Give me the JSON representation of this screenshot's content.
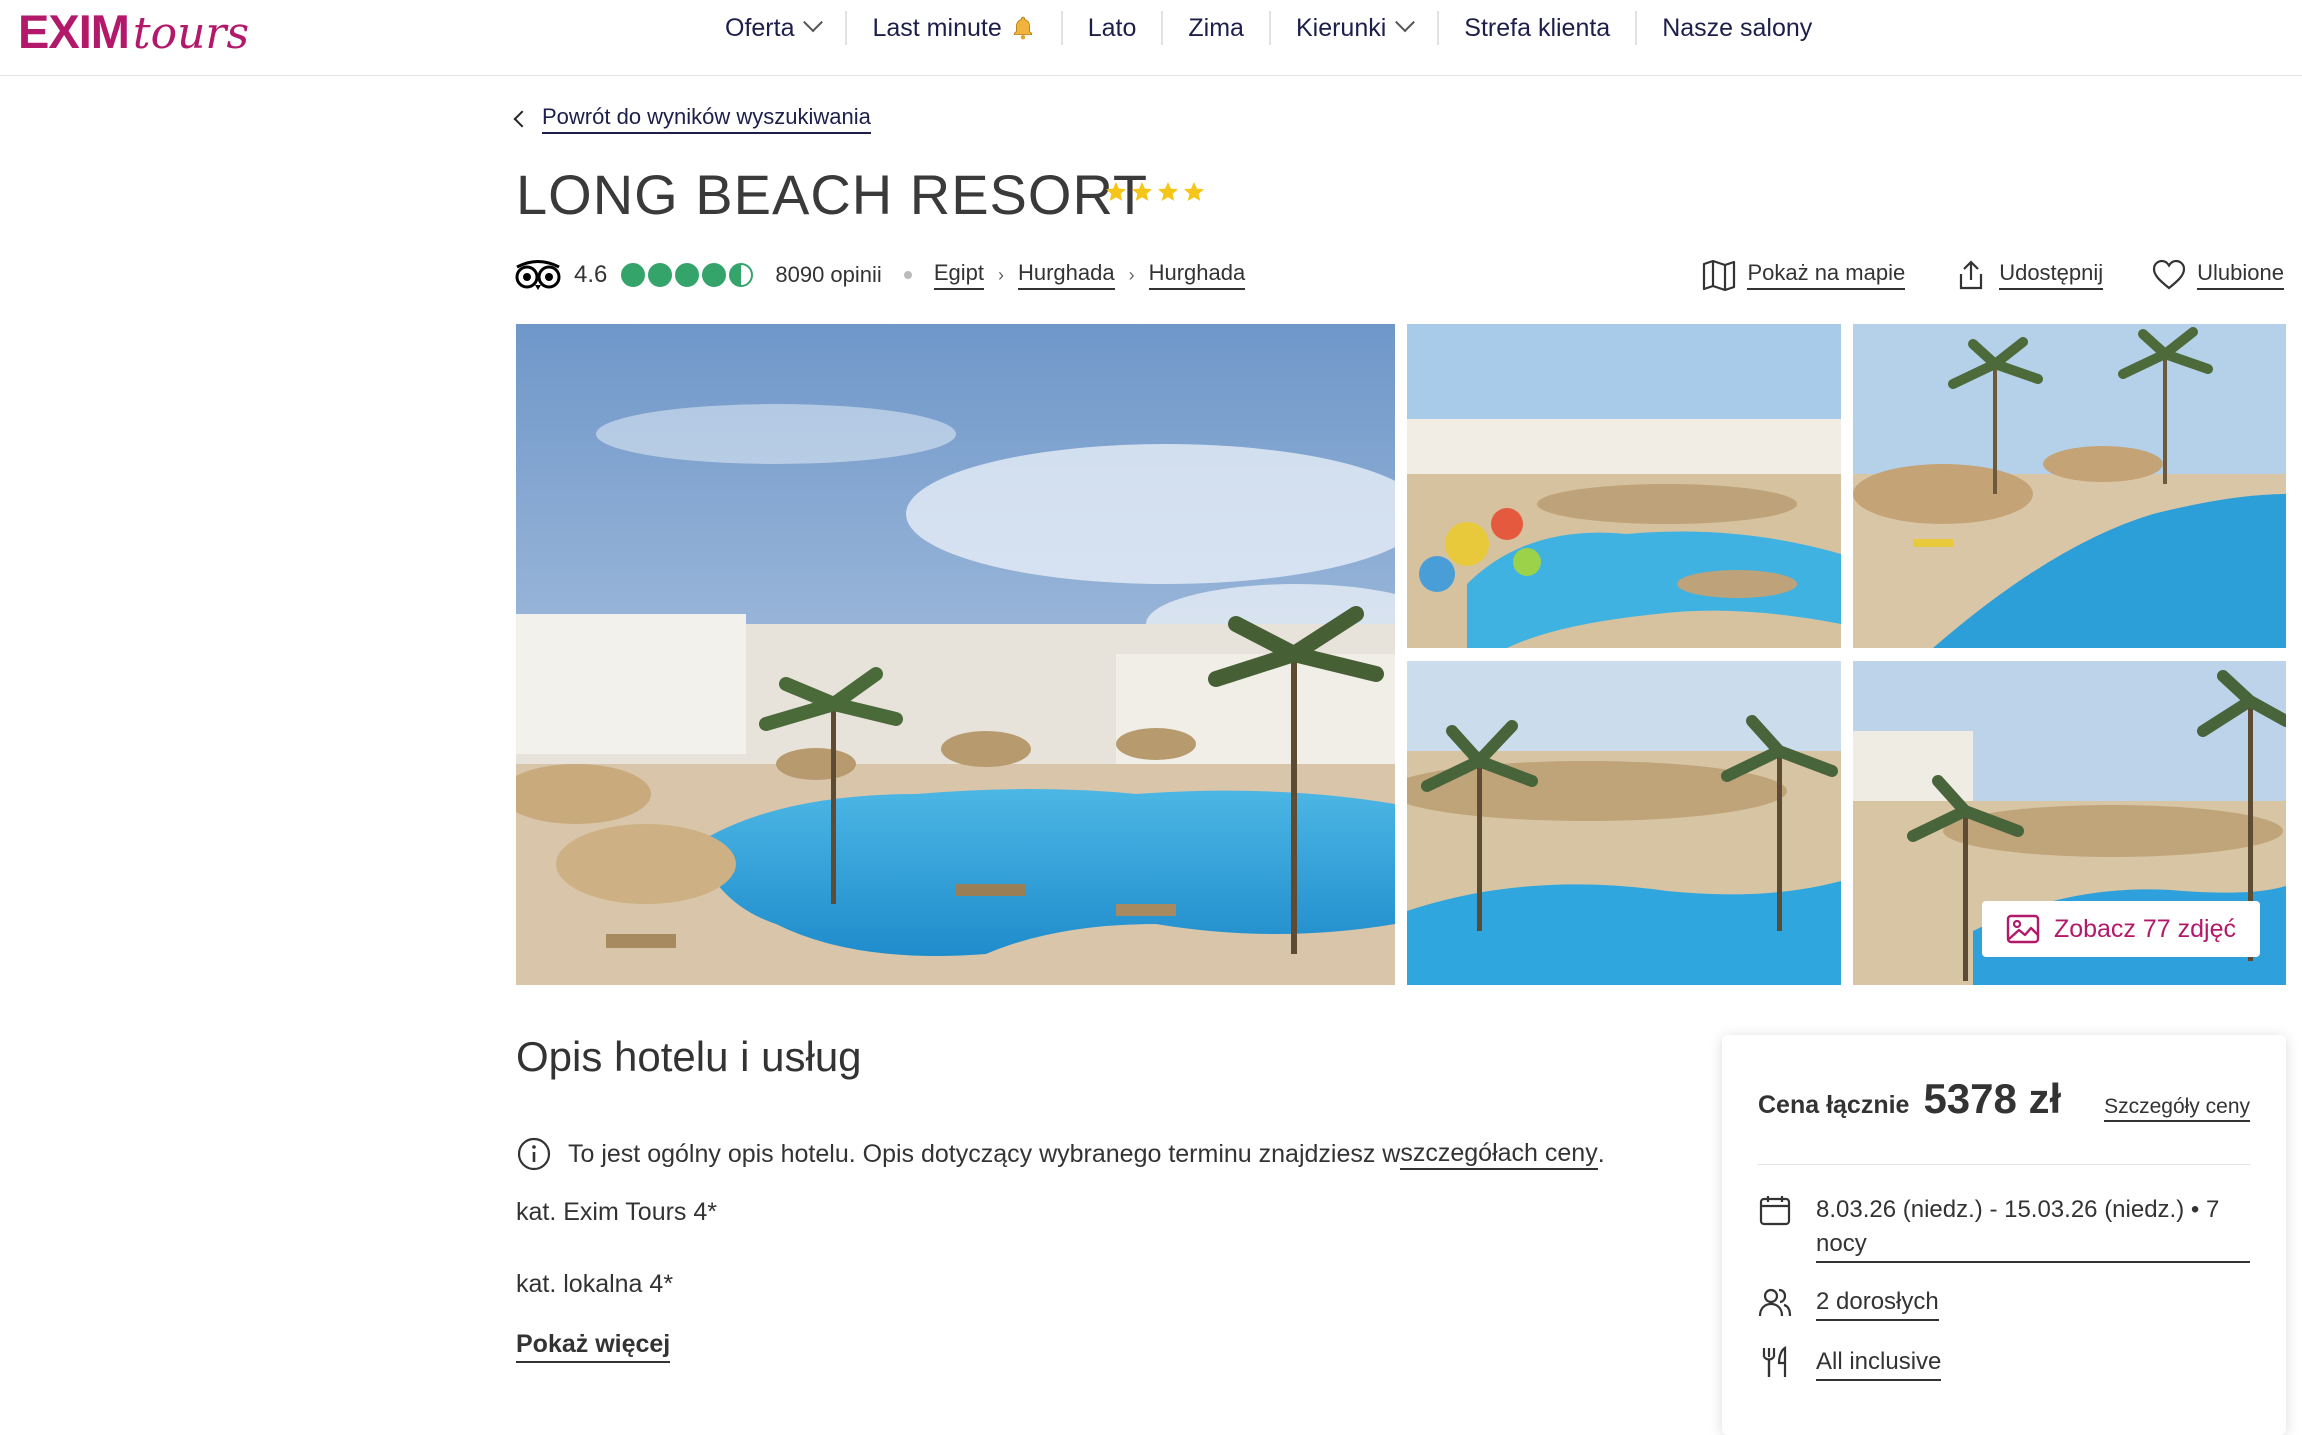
{
  "header": {
    "logo_main": "EXIM",
    "logo_script": "tours",
    "nav": [
      {
        "label": "Oferta",
        "dropdown": true
      },
      {
        "label": "Last minute",
        "icon": "bell-icon"
      },
      {
        "label": "Lato"
      },
      {
        "label": "Zima"
      },
      {
        "label": "Kierunki",
        "dropdown": true
      },
      {
        "label": "Strefa klienta"
      },
      {
        "label": "Nasze salony"
      }
    ]
  },
  "back_link": "Powrót do wyników wyszukiwania",
  "hotel": {
    "name": "LONG BEACH RESORT",
    "stars": 4,
    "rating": "4.6",
    "reviews": "8090 opinii",
    "breadcrumbs": [
      "Egipt",
      "Hurghada",
      "Hurghada"
    ]
  },
  "actions": {
    "map": "Pokaż na mapie",
    "share": "Udostępnij",
    "favorite": "Ulubione"
  },
  "gallery": {
    "see_all": "Zobacz 77 zdjęć"
  },
  "description": {
    "title": "Opis hotelu i usług",
    "info_text": "To jest ogólny opis hotelu. Opis dotyczący wybranego terminu znajdziesz w ",
    "info_link": "szczegółach ceny",
    "info_end": ".",
    "cat_exim": "kat. Exim Tours 4*",
    "cat_local": "kat. lokalna 4*",
    "more": "Pokaż więcej"
  },
  "price_card": {
    "label": "Cena łącznie",
    "price": "5378 zł",
    "details": "Szczegóły ceny",
    "dates": "8.03.26 (niedz.) - 15.03.26 (niedz.) • 7 nocy",
    "travelers": "2 dorosłych",
    "board": "All inclusive"
  },
  "colors": {
    "brand": "#b3196a",
    "nav_text": "#1d1e4a",
    "tripadvisor_green": "#34a46b",
    "star_yellow": "#f5c518"
  }
}
